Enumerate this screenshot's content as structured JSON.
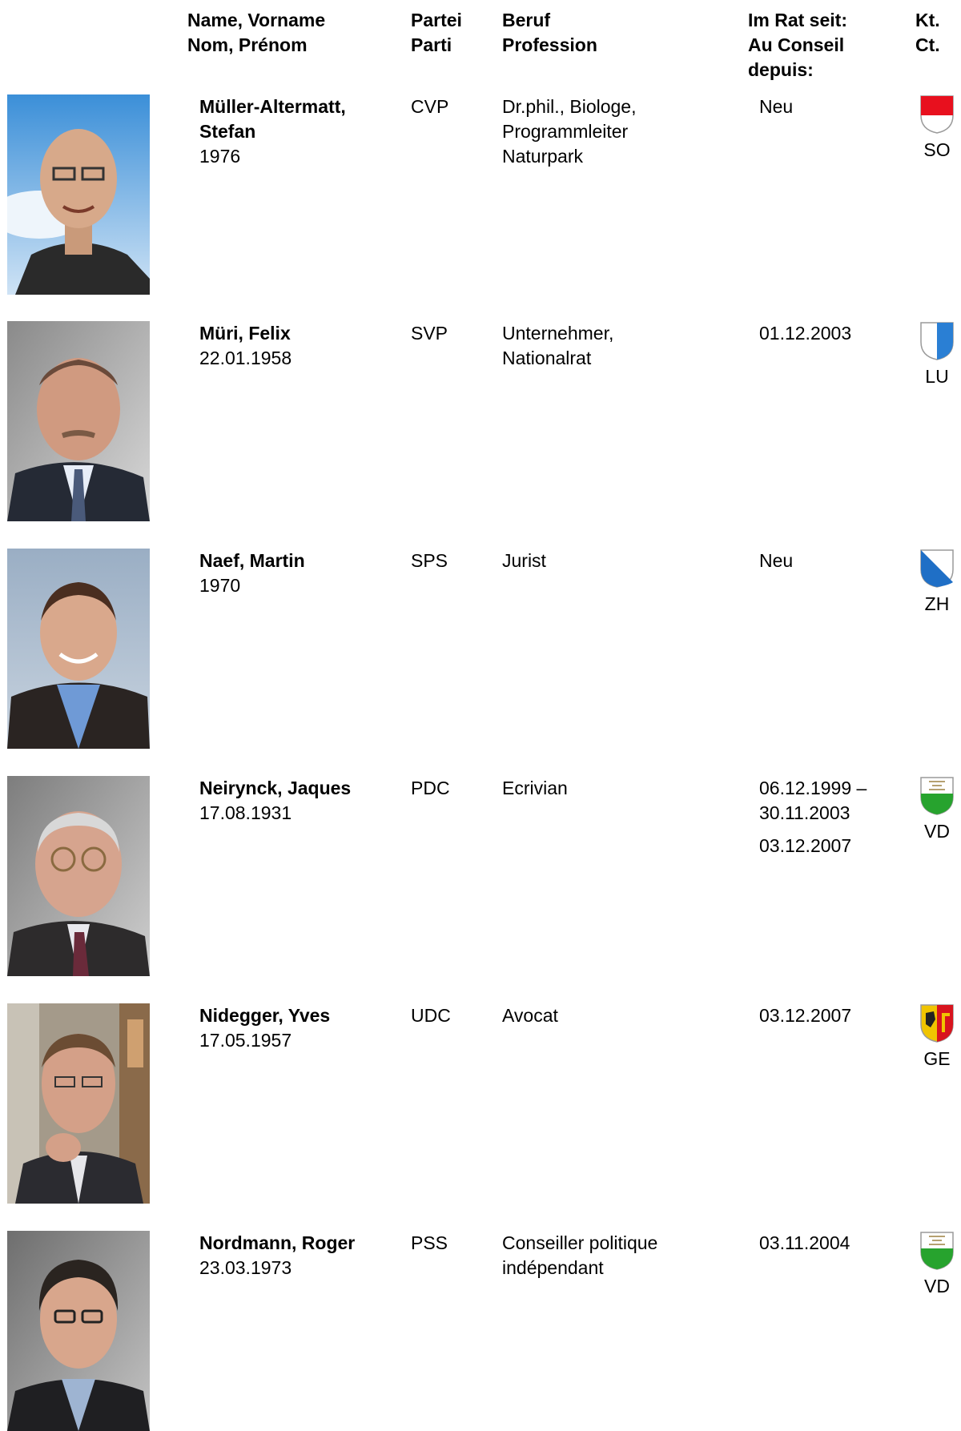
{
  "header": {
    "name_de": "Name, Vorname",
    "name_fr": "Nom, Prénom",
    "party_de": "Partei",
    "party_fr": "Parti",
    "prof_de": "Beruf",
    "prof_fr": "Profession",
    "since_de": "Im Rat seit:",
    "since_fr1": "Au Conseil",
    "since_fr2": "depuis:",
    "canton_de": "Kt.",
    "canton_fr": "Ct."
  },
  "members": [
    {
      "name1": "Müller-Altermatt,",
      "name2": "Stefan",
      "birth": "1976",
      "party": "CVP",
      "prof1": "Dr.phil., Biologe,",
      "prof2": "Programmleiter",
      "prof3": "Naturpark",
      "since1": "Neu",
      "canton": "SO",
      "flag": "solothurn",
      "photo_bg": "sky"
    },
    {
      "name1": "Müri, Felix",
      "birth": "22.01.1958",
      "party": "SVP",
      "prof1": "Unternehmer,",
      "prof2": "Nationalrat",
      "since1": "01.12.2003",
      "canton": "LU",
      "flag": "luzern",
      "photo_bg": "grey"
    },
    {
      "name1": "Naef, Martin",
      "birth": "1970",
      "party": "SPS",
      "prof1": "Jurist",
      "since1": "Neu",
      "canton": "ZH",
      "flag": "zuerich",
      "photo_bg": "grey-blue"
    },
    {
      "name1": "Neirynck, Jaques",
      "birth": "17.08.1931",
      "party": "PDC",
      "prof1": "Ecrivian",
      "since1": "06.12.1999 –",
      "since2": "30.11.2003",
      "since3": "03.12.2007",
      "canton": "VD",
      "flag": "vaud",
      "photo_bg": "grey"
    },
    {
      "name1": "Nidegger, Yves",
      "birth": "17.05.1957",
      "party": "UDC",
      "prof1": "Avocat",
      "since1": "03.12.2007",
      "canton": "GE",
      "flag": "geneve",
      "photo_bg": "street"
    },
    {
      "name1": "Nordmann, Roger",
      "birth": "23.03.1973",
      "party": "PSS",
      "prof1": "Conseiller politique",
      "prof2": "indépendant",
      "since1": "03.11.2004",
      "canton": "VD",
      "flag": "vaud",
      "photo_bg": "grey"
    }
  ],
  "colors": {
    "so_red": "#e8101e",
    "lu_blue": "#2a7fd4",
    "zh_blue": "#1f6fc6",
    "vd_green": "#27a32e",
    "ge_yellow": "#f0c400",
    "ge_red": "#d8141e"
  }
}
